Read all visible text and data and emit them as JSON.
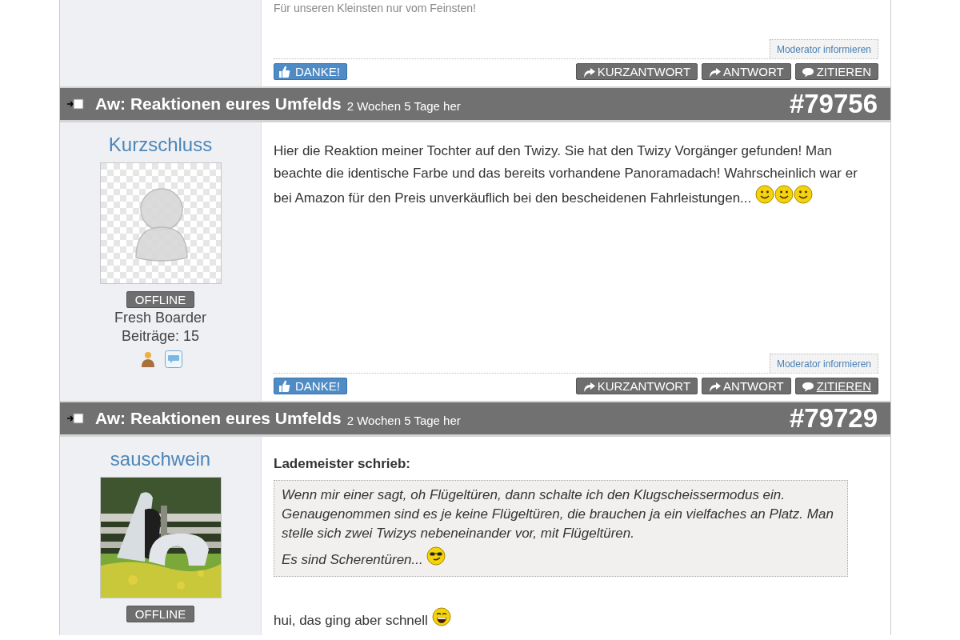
{
  "top_post": {
    "signature": "Für unseren Kleinsten nur vom Feinsten!",
    "report_link": "Moderator informieren",
    "thanks_button": "DANKE!",
    "actions": [
      {
        "label": "KURZANTWORT",
        "kind": "reply",
        "hovered": false
      },
      {
        "label": "ANTWORT",
        "kind": "reply",
        "hovered": false
      },
      {
        "label": "ZITIEREN",
        "kind": "quote",
        "hovered": false
      }
    ]
  },
  "posts": [
    {
      "title": "Aw: Reaktionen eures Umfelds",
      "age": "2 Wochen 5 Tage her",
      "number": "#79756",
      "author": {
        "name": "Kurzschluss",
        "avatar": {
          "kind": "placeholder"
        },
        "status": "OFFLINE",
        "rank": "Fresh Boarder",
        "count": "Beiträge: 15",
        "profile_icons": true
      },
      "body": [
        {
          "kind": "text",
          "text": "Hier die Reaktion meiner Tochter auf den Twizy. Sie hat den Twizy Vorgänger gefunden! Man beachte die identische Farbe und das bereits vorhandene Panoramadach! Wahrscheinlich war er bei Amazon für den Preis unverkäuflich bei den bescheidenen Fahrleistungen... "
        },
        {
          "kind": "smile"
        },
        {
          "kind": "smile"
        },
        {
          "kind": "smile"
        }
      ],
      "report_link": "Moderator informieren",
      "thanks_button": "DANKE!",
      "actions": [
        {
          "label": "KURZANTWORT",
          "kind": "reply",
          "hovered": false
        },
        {
          "label": "ANTWORT",
          "kind": "reply",
          "hovered": false
        },
        {
          "label": "ZITIEREN",
          "kind": "quote",
          "hovered": true
        }
      ]
    },
    {
      "title": "Aw: Reaktionen eures Umfelds",
      "age": "2 Wochen 5 Tage her",
      "number": "#79729",
      "author": {
        "name": "sauschwein",
        "status": "OFFLINE"
      },
      "quote": {
        "author_line": "Lademeister schrieb:",
        "paragraphs": [
          [
            {
              "kind": "text",
              "text": "Wenn mir einer sagt, oh Flügeltüren, dann schalte ich den Klugscheissermodus ein. Genaugenommen sind es je keine Flügeltüren, die brauchen ja ein vielfaches an Platz. Man stelle sich zwei Twizys nebeneinander vor, mit Flügeltüren."
            }
          ],
          [
            {
              "kind": "text",
              "text": "Es sind Scherentüren... "
            },
            {
              "kind": "cool"
            }
          ]
        ]
      },
      "body": [
        {
          "kind": "text",
          "text": "hui, das ging aber schnell "
        },
        {
          "kind": "grin"
        }
      ]
    }
  ]
}
